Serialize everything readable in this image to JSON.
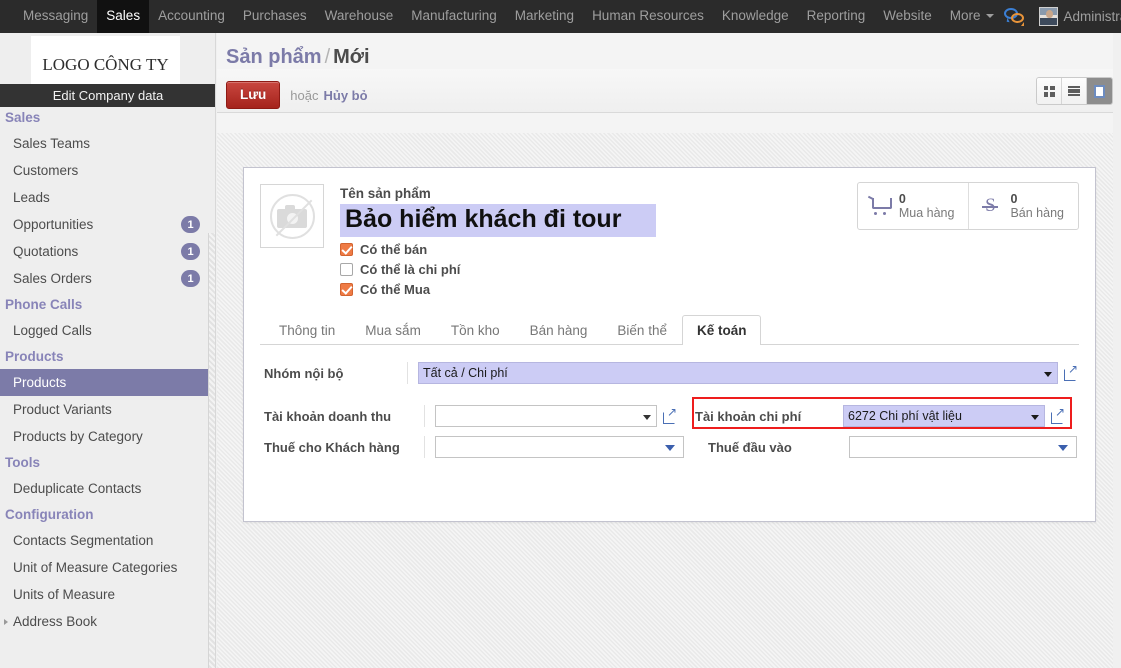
{
  "topbar": {
    "menu": [
      {
        "label": "Messaging",
        "active": false
      },
      {
        "label": "Sales",
        "active": true
      },
      {
        "label": "Accounting",
        "active": false
      },
      {
        "label": "Purchases",
        "active": false
      },
      {
        "label": "Warehouse",
        "active": false
      },
      {
        "label": "Manufacturing",
        "active": false
      },
      {
        "label": "Marketing",
        "active": false
      },
      {
        "label": "Human Resources",
        "active": false
      },
      {
        "label": "Knowledge",
        "active": false
      },
      {
        "label": "Reporting",
        "active": false
      },
      {
        "label": "Website",
        "active": false
      },
      {
        "label": "More",
        "active": false
      }
    ],
    "more_label": "More",
    "chat_icon": "chat-bubbles-icon",
    "user": "Administrator"
  },
  "sidebar": {
    "logo_text": "LOGO CÔNG TY",
    "tooltip": "Edit Company data",
    "groups": [
      {
        "title": "Sales",
        "items": [
          {
            "label": "Sales Teams",
            "badge": "",
            "selected": false
          },
          {
            "label": "Customers",
            "badge": "",
            "selected": false
          },
          {
            "label": "Leads",
            "badge": "",
            "selected": false
          },
          {
            "label": "Opportunities",
            "badge": "1",
            "selected": false
          },
          {
            "label": "Quotations",
            "badge": "1",
            "selected": false
          },
          {
            "label": "Sales Orders",
            "badge": "1",
            "selected": false
          }
        ]
      },
      {
        "title": "Phone Calls",
        "items": [
          {
            "label": "Logged Calls",
            "badge": "",
            "selected": false
          }
        ]
      },
      {
        "title": "Products",
        "items": [
          {
            "label": "Products",
            "badge": "",
            "selected": true
          },
          {
            "label": "Product Variants",
            "badge": "",
            "selected": false
          },
          {
            "label": "Products by Category",
            "badge": "",
            "selected": false
          }
        ]
      },
      {
        "title": "Tools",
        "items": [
          {
            "label": "Deduplicate Contacts",
            "badge": "",
            "selected": false
          }
        ]
      },
      {
        "title": "Configuration",
        "items": [
          {
            "label": "Contacts Segmentation",
            "badge": "",
            "selected": false
          },
          {
            "label": "Unit of Measure Categories",
            "badge": "",
            "selected": false
          },
          {
            "label": "Units of Measure",
            "badge": "",
            "selected": false
          },
          {
            "label": "Address Book",
            "badge": "",
            "selected": false,
            "expandable": true
          }
        ]
      }
    ]
  },
  "breadcrumb": {
    "root": "Sản phẩm",
    "separator": "/",
    "current": "Mới"
  },
  "toolbar": {
    "save_label": "Lưu",
    "or_label": "hoặc",
    "discard_label": "Hủy bỏ",
    "views": [
      {
        "name": "kanban-view-button",
        "icon": "grid-icon",
        "active": false
      },
      {
        "name": "list-view-button",
        "icon": "list-icon",
        "active": false
      },
      {
        "name": "form-view-button",
        "icon": "form-icon",
        "active": true
      }
    ]
  },
  "form": {
    "image_placeholder_icon": "no-camera-icon",
    "name_label": "Tên sản phẩm",
    "name_value": "Bảo hiểm khách đi tour",
    "checkboxes": [
      {
        "label": "Có thể bán",
        "checked": true
      },
      {
        "label": "Có thể là chi phí",
        "checked": false
      },
      {
        "label": "Có thể Mua",
        "checked": true
      }
    ],
    "stats": [
      {
        "icon": "shopping-cart-icon",
        "value": "0",
        "label": "Mua hàng"
      },
      {
        "icon": "sales-s-icon",
        "value": "0",
        "label": "Bán hàng"
      }
    ],
    "tabs": [
      {
        "label": "Thông tin",
        "active": false
      },
      {
        "label": "Mua sắm",
        "active": false
      },
      {
        "label": "Tồn kho",
        "active": false
      },
      {
        "label": "Bán hàng",
        "active": false
      },
      {
        "label": "Biến thể",
        "active": false
      },
      {
        "label": "Kế toán",
        "active": true
      }
    ],
    "fields": {
      "internal_group": {
        "label": "Nhóm nội bộ",
        "value": "Tất cả / Chi phí",
        "filled": true
      },
      "income_account": {
        "label": "Tài khoản doanh thu",
        "value": "",
        "filled": false
      },
      "customer_tax": {
        "label": "Thuế cho Khách hàng",
        "value": "",
        "filled": false
      },
      "expense_account": {
        "label": "Tài khoản chi phí",
        "value": "6272 Chi phí vật liệu",
        "filled": true,
        "highlighted": true
      },
      "input_tax": {
        "label": "Thuế đầu vào",
        "value": "",
        "filled": false
      }
    }
  },
  "colors": {
    "accent_purple": "#7c7ba8",
    "save_red": "#a5231c",
    "highlight_red": "#ee1d1d",
    "field_lavender": "#ccccf5",
    "checkbox_orange": "#ef7b45",
    "navbar_dark": "#2b2b2b"
  }
}
